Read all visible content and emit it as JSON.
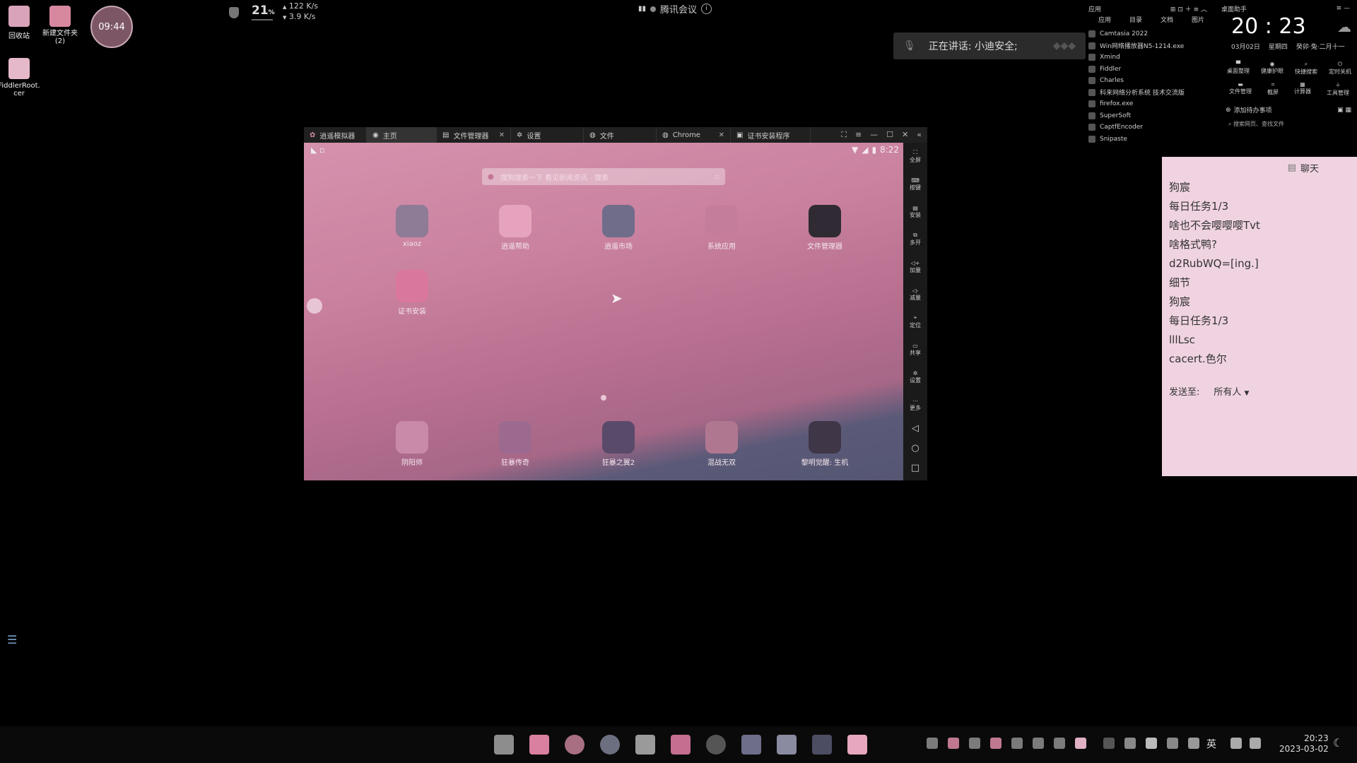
{
  "desktop_icons": [
    {
      "label": "回收站"
    },
    {
      "label": "新建文件夹\n(2)"
    },
    {
      "label": "FiddlerRoot.\ncer"
    }
  ],
  "clock_bubble": "09:44",
  "topbar": {
    "cpu": "21",
    "cpu_unit": "%",
    "net_up": "122 K/s",
    "net_down": "3.9 K/s",
    "meeting": "腾讯会议",
    "speaking": "正在讲话: 小迪安全;"
  },
  "app_panel": {
    "tabs": [
      "应用",
      "目录",
      "文档",
      "图片"
    ],
    "header": "应用",
    "items": [
      "Camtasia 2022",
      "Win网络播放器N5-1214.exe",
      "Xmind",
      "Fiddler",
      "Charles",
      "科来网络分析系统 技术交流版",
      "firefox.exe",
      "SuperSoft",
      "CaptfEncoder",
      "Snipaste"
    ]
  },
  "helper": {
    "title": "桌面助手",
    "time": "20 : 23",
    "date": "03月02日",
    "weekday": "星期四",
    "lunar": "癸卯·兔·二月十一",
    "tools_row1": [
      "桌面整理",
      "健康护眼",
      "快捷搜索",
      "定时关机"
    ],
    "tools_row2": [
      "文件管理",
      "截屏",
      "计算器",
      "工具管理"
    ],
    "todo": "添加待办事项",
    "search": "搜索网页、查找文件"
  },
  "emulator": {
    "tabs": [
      {
        "label": "逍遥模拟器",
        "closable": false
      },
      {
        "label": "主页",
        "closable": false
      },
      {
        "label": "文件管理器",
        "closable": true
      },
      {
        "label": "设置",
        "closable": false
      },
      {
        "label": "文件",
        "closable": false
      },
      {
        "label": "Chrome",
        "closable": true
      },
      {
        "label": "证书安装程序",
        "closable": false
      }
    ],
    "status_time": "8:22",
    "search_placeholder": "搜狗搜索一下 看见新闻资讯 - 搜索",
    "apps_row1": [
      "xiaoz",
      "逍遥帮助",
      "逍遥市场",
      "系统应用",
      "文件管理器"
    ],
    "apps_row2": [
      "证书安装"
    ],
    "dock": [
      "阴阳师",
      "狂暴传奇",
      "狂暴之翼2",
      "混战无双",
      "黎明觉醒: 生机"
    ],
    "side_tools": [
      "全屏",
      "按键",
      "安装",
      "多开",
      "加量",
      "减量",
      "定位",
      "共享",
      "设置",
      "更多"
    ]
  },
  "chat": {
    "title": "聊天",
    "messages": [
      "狗宸",
      "每日任务1/3",
      "啥也不会嘤嘤嘤Tvt",
      "啥格式鸭?",
      "d2RubWQ=[ing.]",
      "细节",
      "狗宸",
      "每日任务1/3",
      "lllLsc",
      "cacert.色尔"
    ],
    "send_to_label": "发送至:",
    "send_to_value": "所有人"
  },
  "taskbar": {
    "time": "20:23",
    "date": "2023-03-02",
    "ime": "英"
  },
  "colors": {
    "chat_bg": "#f0d3e1",
    "emu_accent": "#c9819f"
  }
}
